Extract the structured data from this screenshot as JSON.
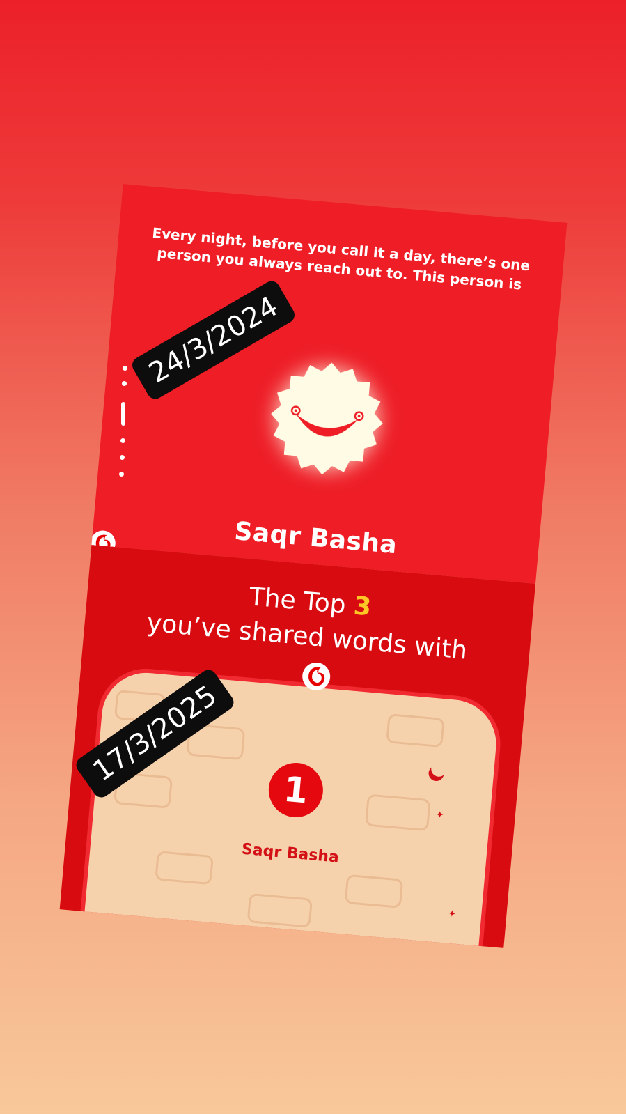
{
  "story_2024": {
    "intro_text": "Every night, before you call it a day, there’s one person you always reach out to. This person is",
    "contact_name": "Saqr Basha",
    "icon": "smiling-flower-icon",
    "logo": "vodafone-logo-icon"
  },
  "story_2025": {
    "title_prefix": "The Top",
    "title_number": "3",
    "title_line2": "you’ve shared words with",
    "logo": "vodafone-logo-icon",
    "top_contacts": [
      {
        "rank": "1",
        "name": "Saqr Basha"
      }
    ]
  },
  "date_labels": {
    "first": "24/3/2024",
    "second": "17/3/2025"
  },
  "colors": {
    "brand_red": "#ee1d26",
    "accent_yellow": "#ffc726",
    "panel_cream": "#f6d2ac"
  }
}
